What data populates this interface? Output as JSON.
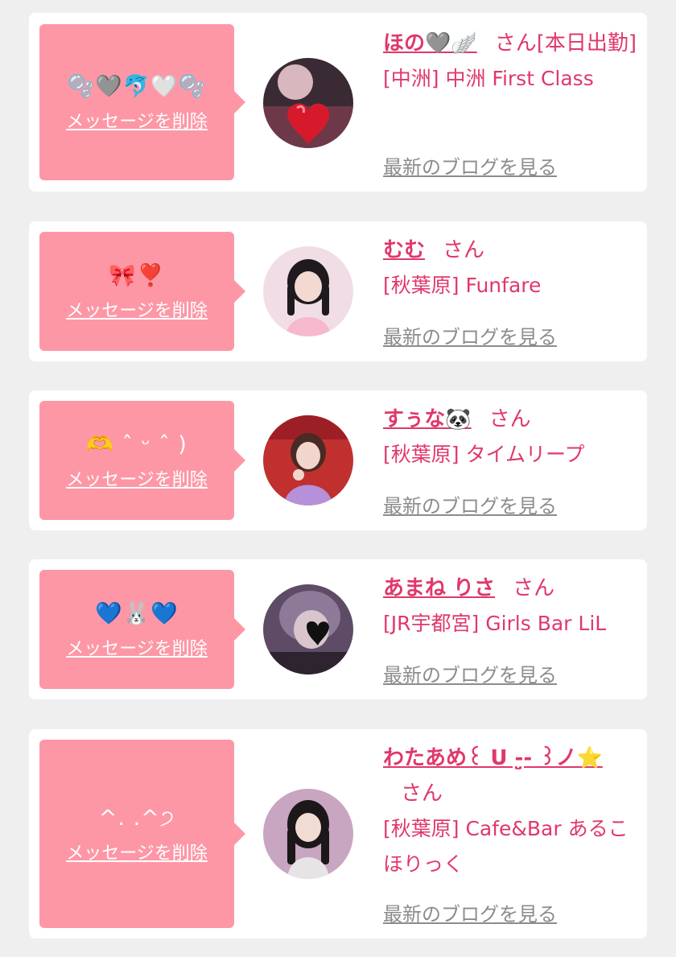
{
  "common": {
    "delete_label": "メッセージを削除",
    "blog_label": "最新のブログを見る",
    "honorific": "さん"
  },
  "colors": {
    "bubble": "#fd97a6",
    "accent": "#e0386a",
    "link_gray": "#8c8c8c",
    "background": "#efefef"
  },
  "cards": [
    {
      "message": "🫧🩶🐬🤍🫧",
      "name": "ほの🩶🪽",
      "name_suffix": "[本日出勤]",
      "shop": "[中洲] 中洲 First Class",
      "avatar": "avatar-photo"
    },
    {
      "message": "🎀❣️",
      "name": "むむ",
      "name_suffix": "",
      "shop": "[秋葉原] Funfare",
      "avatar": "avatar-photo"
    },
    {
      "message": "🫶 ˆ ᵕ ˆ )",
      "name": "すぅな🐼",
      "name_suffix": "",
      "shop": "[秋葉原] タイムリープ",
      "avatar": "avatar-photo"
    },
    {
      "message": "💙🐰💙",
      "name": "あまね りさ",
      "name_suffix": "",
      "shop": "[JR宇都宮] Girls Bar LiL",
      "avatar": "avatar-photo"
    },
    {
      "message": "^. .^੭",
      "name": "わたあめ꒰ ᑌ -̤̮- ꒱ノ⭐️",
      "name_suffix": "",
      "shop": "[秋葉原] Cafe&Bar あるこほりっく",
      "avatar": "avatar-photo"
    }
  ]
}
